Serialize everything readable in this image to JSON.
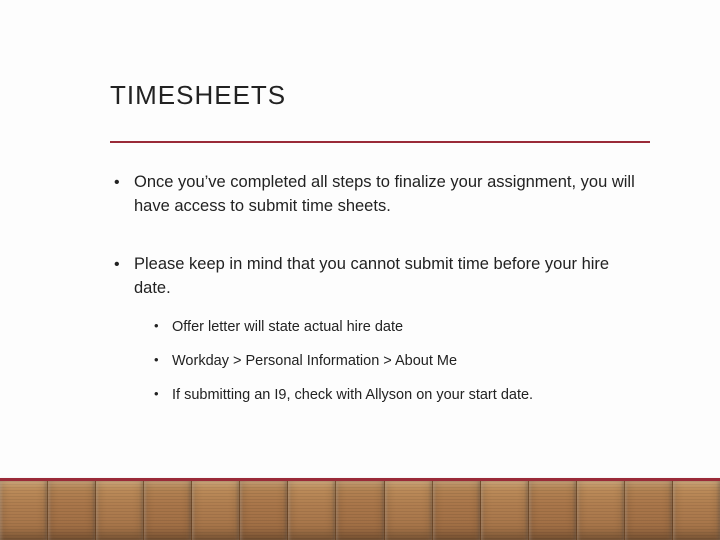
{
  "title": "TIMESHEETS",
  "bullets": [
    {
      "text": "Once you’ve completed all steps to finalize your assignment, you will have access to submit time sheets.",
      "sub": []
    },
    {
      "text": "Please keep in mind that you cannot submit time before your hire date.",
      "sub": [
        "Offer letter will state actual hire date",
        "Workday > Personal Information > About Me",
        "If submitting an I9, check with Allyson on your start date."
      ]
    }
  ],
  "accent_color": "#9a2a38"
}
